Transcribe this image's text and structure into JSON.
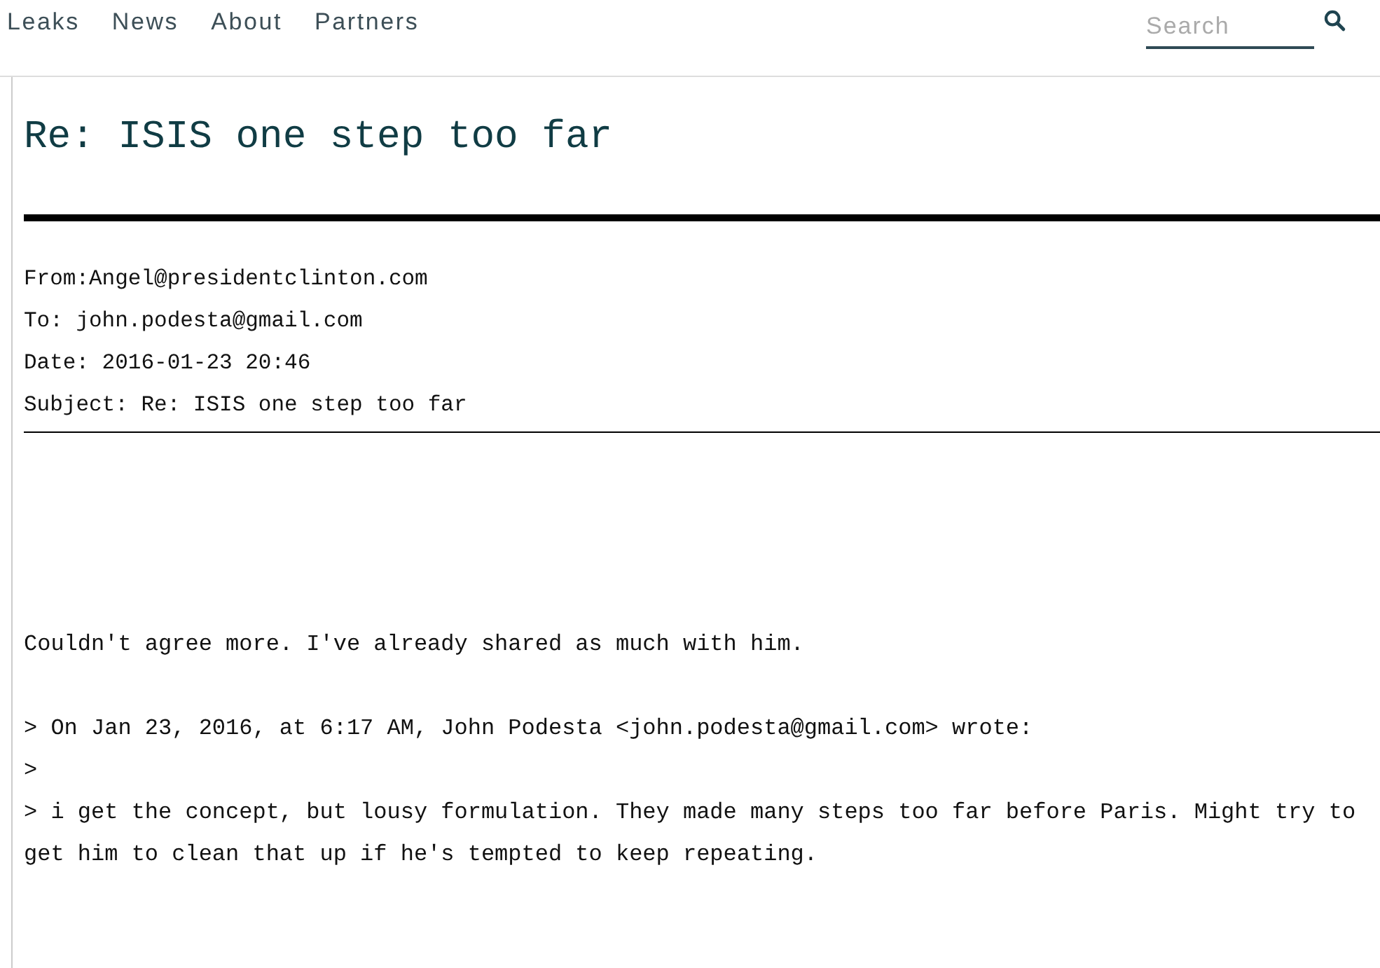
{
  "nav": [
    {
      "label": "Leaks"
    },
    {
      "label": "News"
    },
    {
      "label": "About"
    },
    {
      "label": "Partners"
    }
  ],
  "search": {
    "placeholder": "Search"
  },
  "email": {
    "title": "Re: ISIS one step too far",
    "headers": [
      "From:Angel@presidentclinton.com",
      "To: john.podesta@gmail.com",
      "Date: 2016-01-23 20:46",
      "Subject: Re: ISIS one step too far"
    ],
    "body": [
      "Couldn't agree more. I've already shared as much with him.",
      "> On Jan 23, 2016, at 6:17 AM, John Podesta <john.podesta@gmail.com> wrote:",
      ">",
      "> i get the concept, but lousy formulation. They made many steps too far before Paris. Might try to get him to clean that up if he's tempted to keep repeating."
    ]
  }
}
